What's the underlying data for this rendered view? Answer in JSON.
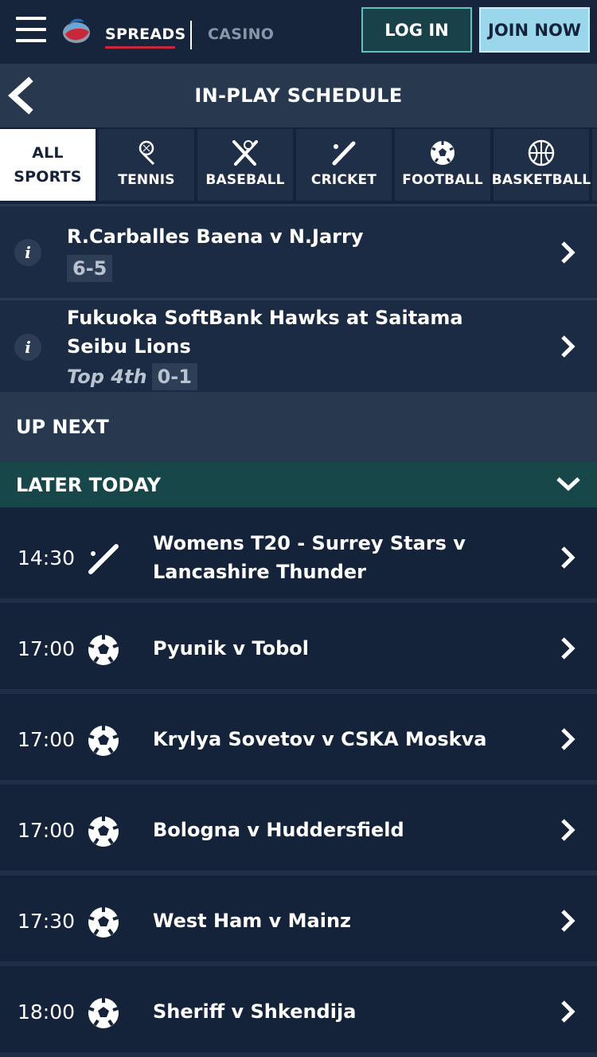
{
  "header": {
    "nav_spreads": "SPREADS",
    "nav_casino": "CASINO",
    "login_label": "LOG IN",
    "join_label": "JOIN NOW",
    "accent_color": "#c8283c",
    "login_border_color": "#63c0bd",
    "join_bg_color": "#9ad7ec"
  },
  "titlebar": {
    "title": "IN-PLAY SCHEDULE"
  },
  "tabs": [
    {
      "label_line1": "ALL",
      "label_line2": "SPORTS",
      "icon": null,
      "active": true
    },
    {
      "label": "TENNIS",
      "icon": "tennis-icon"
    },
    {
      "label": "BASEBALL",
      "icon": "baseball-icon"
    },
    {
      "label": "CRICKET",
      "icon": "cricket-icon"
    },
    {
      "label": "FOOTBALL",
      "icon": "football-icon"
    },
    {
      "label": "BASKETBALL",
      "icon": "basketball-icon"
    }
  ],
  "live_events": [
    {
      "title": "R.Carballes Baena v N.Jarry",
      "score": "6-5",
      "period": ""
    },
    {
      "title": "Fukuoka SoftBank Hawks at Saitama Seibu Lions",
      "score": "0-1",
      "period": "Top 4th"
    }
  ],
  "sections": {
    "up_next": "UP NEXT",
    "later_today": "LATER TODAY"
  },
  "events": [
    {
      "time": "14:30",
      "sport": "cricket-icon",
      "name": "Womens T20 - Surrey Stars v Lancashire Thunder"
    },
    {
      "time": "17:00",
      "sport": "football-icon",
      "name": "Pyunik v Tobol"
    },
    {
      "time": "17:00",
      "sport": "football-icon",
      "name": "Krylya Sovetov v CSKA Moskva"
    },
    {
      "time": "17:00",
      "sport": "football-icon",
      "name": "Bologna v Huddersfield"
    },
    {
      "time": "17:30",
      "sport": "football-icon",
      "name": "West Ham v Mainz"
    },
    {
      "time": "18:00",
      "sport": "football-icon",
      "name": "Sheriff v Shkendija"
    }
  ]
}
